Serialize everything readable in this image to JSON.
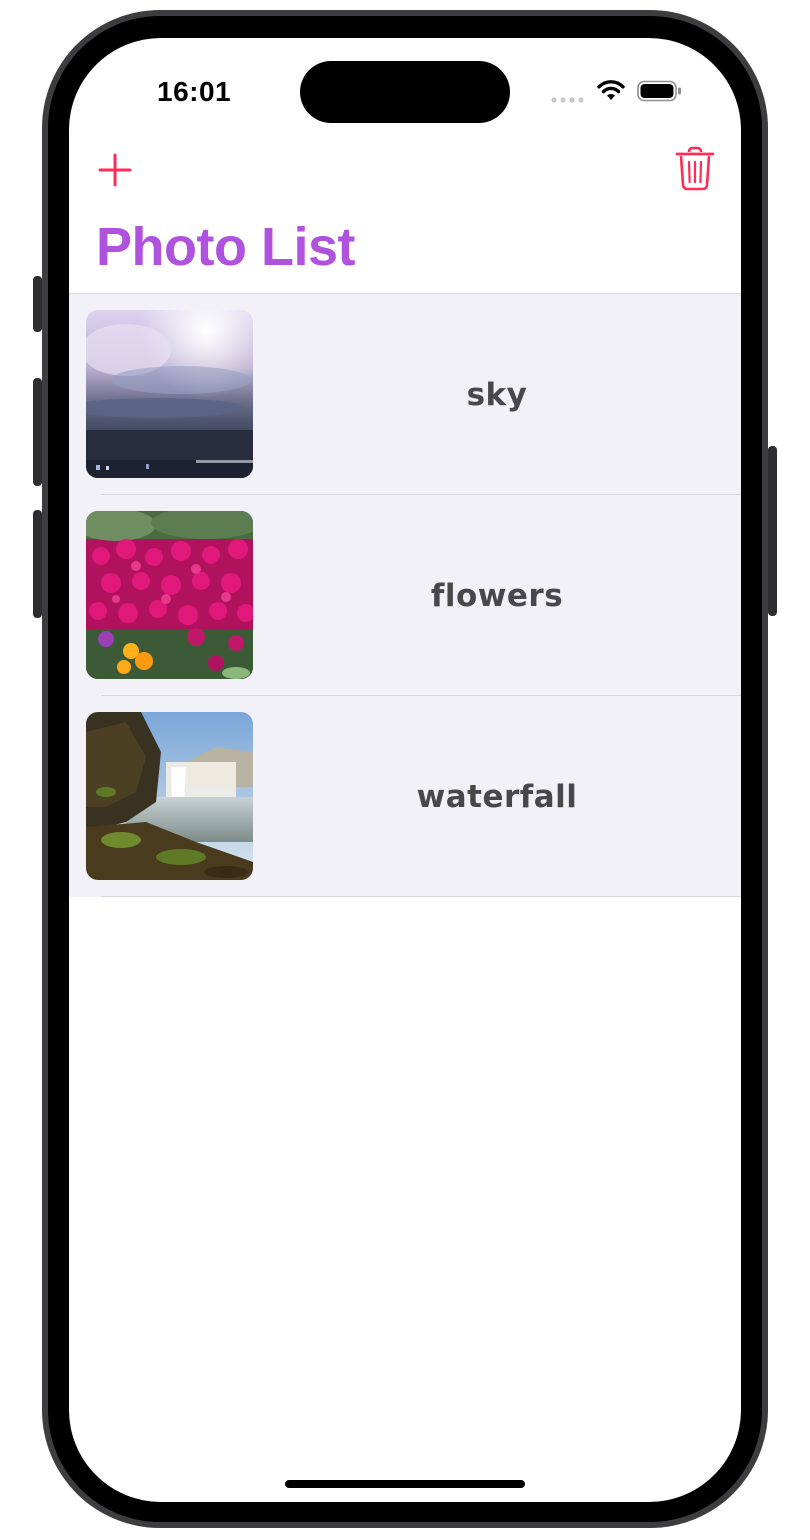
{
  "status_bar": {
    "time": "16:01",
    "icons": [
      "cellular-signal-icon",
      "wifi-icon",
      "battery-icon"
    ]
  },
  "nav_bar": {
    "add_icon": "plus-icon",
    "delete_icon": "trash-icon",
    "title": "Photo List"
  },
  "photos": [
    {
      "label": "sky",
      "thumbnail": "sky-photo"
    },
    {
      "label": "flowers",
      "thumbnail": "flowers-photo"
    },
    {
      "label": "waterfall",
      "thumbnail": "waterfall-photo"
    }
  ],
  "colors": {
    "accent": "#ff2d55",
    "title": "#af52de",
    "list_background": "#f2f1f7",
    "row_text": "#48484a"
  }
}
